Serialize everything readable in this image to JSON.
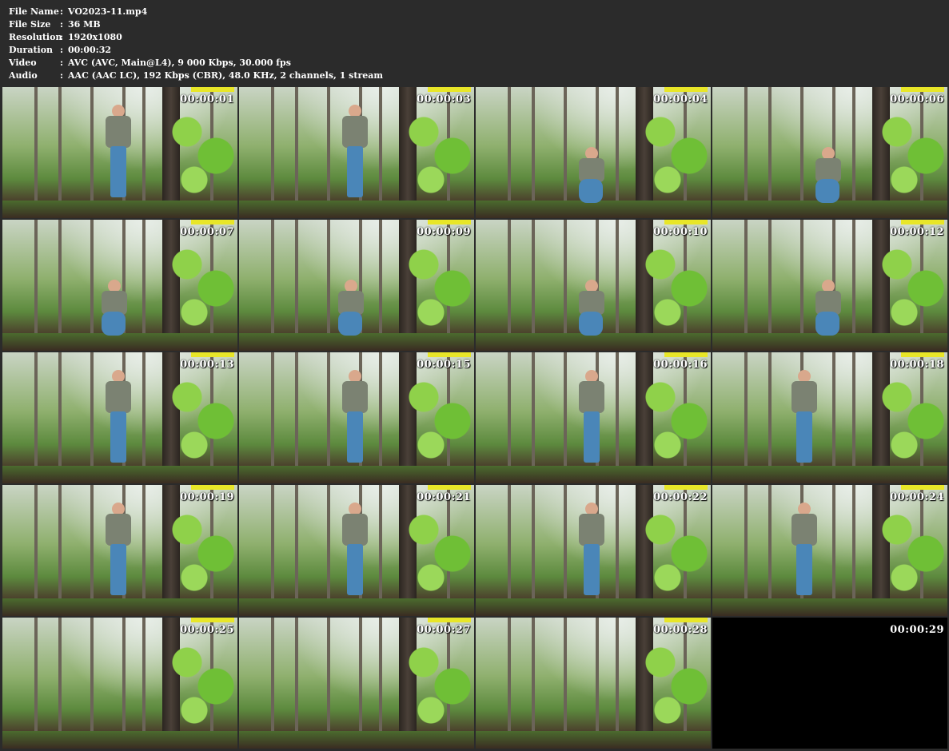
{
  "info": [
    {
      "key": "File Name",
      "value": "VO2023-11.mp4"
    },
    {
      "key": "File Size",
      "value": "36 MB"
    },
    {
      "key": "Resolution",
      "value": "1920x1080"
    },
    {
      "key": "Duration",
      "value": "00:00:32"
    },
    {
      "key": "Video",
      "value": "AVC (AVC, Main@L4), 9 000 Kbps, 30.000 fps"
    },
    {
      "key": "Audio",
      "value": "AAC (AAC LC), 192 Kbps (CBR), 48.0 KHz, 2 channels, 1 stream"
    }
  ],
  "separator": ":",
  "thumbnails": [
    {
      "time": "00:00:01",
      "pose": "standing-back"
    },
    {
      "time": "00:00:03",
      "pose": "standing-back"
    },
    {
      "time": "00:00:04",
      "pose": "crouching"
    },
    {
      "time": "00:00:06",
      "pose": "crouching"
    },
    {
      "time": "00:00:07",
      "pose": "crouching"
    },
    {
      "time": "00:00:09",
      "pose": "crouching"
    },
    {
      "time": "00:00:10",
      "pose": "crouching"
    },
    {
      "time": "00:00:12",
      "pose": "crouching"
    },
    {
      "time": "00:00:13",
      "pose": "standing"
    },
    {
      "time": "00:00:15",
      "pose": "standing"
    },
    {
      "time": "00:00:16",
      "pose": "standing"
    },
    {
      "time": "00:00:18",
      "pose": "standing"
    },
    {
      "time": "00:00:19",
      "pose": "standing"
    },
    {
      "time": "00:00:21",
      "pose": "standing"
    },
    {
      "time": "00:00:22",
      "pose": "standing"
    },
    {
      "time": "00:00:24",
      "pose": "standing"
    },
    {
      "time": "00:00:25",
      "pose": "none"
    },
    {
      "time": "00:00:27",
      "pose": "none"
    },
    {
      "time": "00:00:28",
      "pose": "none"
    },
    {
      "time": "00:00:29",
      "pose": "black"
    }
  ]
}
